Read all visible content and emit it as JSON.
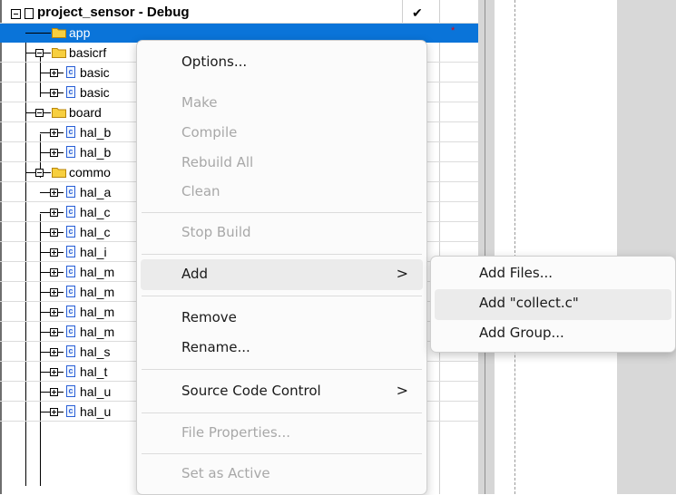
{
  "tree": {
    "root": {
      "label": "project_sensor - Debug",
      "check": "✔"
    },
    "rows": [
      {
        "label": "app"
      },
      {
        "label": "basicrf"
      },
      {
        "label": "basic"
      },
      {
        "label": "basic"
      },
      {
        "label": "board"
      },
      {
        "label": "hal_b"
      },
      {
        "label": "hal_b"
      },
      {
        "label": "commo"
      },
      {
        "label": "hal_a"
      },
      {
        "label": "hal_c"
      },
      {
        "label": "hal_c"
      },
      {
        "label": "hal_i"
      },
      {
        "label": "hal_m"
      },
      {
        "label": "hal_m"
      },
      {
        "label": "hal_m"
      },
      {
        "label": "hal_m"
      },
      {
        "label": "hal_s"
      },
      {
        "label": "hal_t"
      },
      {
        "label": "hal_u"
      },
      {
        "label": "hal_u"
      }
    ],
    "c_glyph": "c",
    "modified_marker": "*",
    "selection_color": "#0a74d9"
  },
  "context_menu": {
    "items": [
      {
        "label": "Options..."
      },
      {
        "label": "Make"
      },
      {
        "label": "Compile"
      },
      {
        "label": "Rebuild All"
      },
      {
        "label": "Clean"
      },
      {
        "label": "Stop Build"
      },
      {
        "label": "Add",
        "arrow": ">"
      },
      {
        "label": "Remove"
      },
      {
        "label": "Rename..."
      },
      {
        "label": "Source Code Control",
        "arrow": ">"
      },
      {
        "label": "File Properties..."
      },
      {
        "label": "Set as Active"
      }
    ]
  },
  "add_submenu": {
    "items": [
      {
        "label": "Add Files..."
      },
      {
        "label": "Add \"collect.c\""
      },
      {
        "label": "Add Group..."
      }
    ]
  }
}
